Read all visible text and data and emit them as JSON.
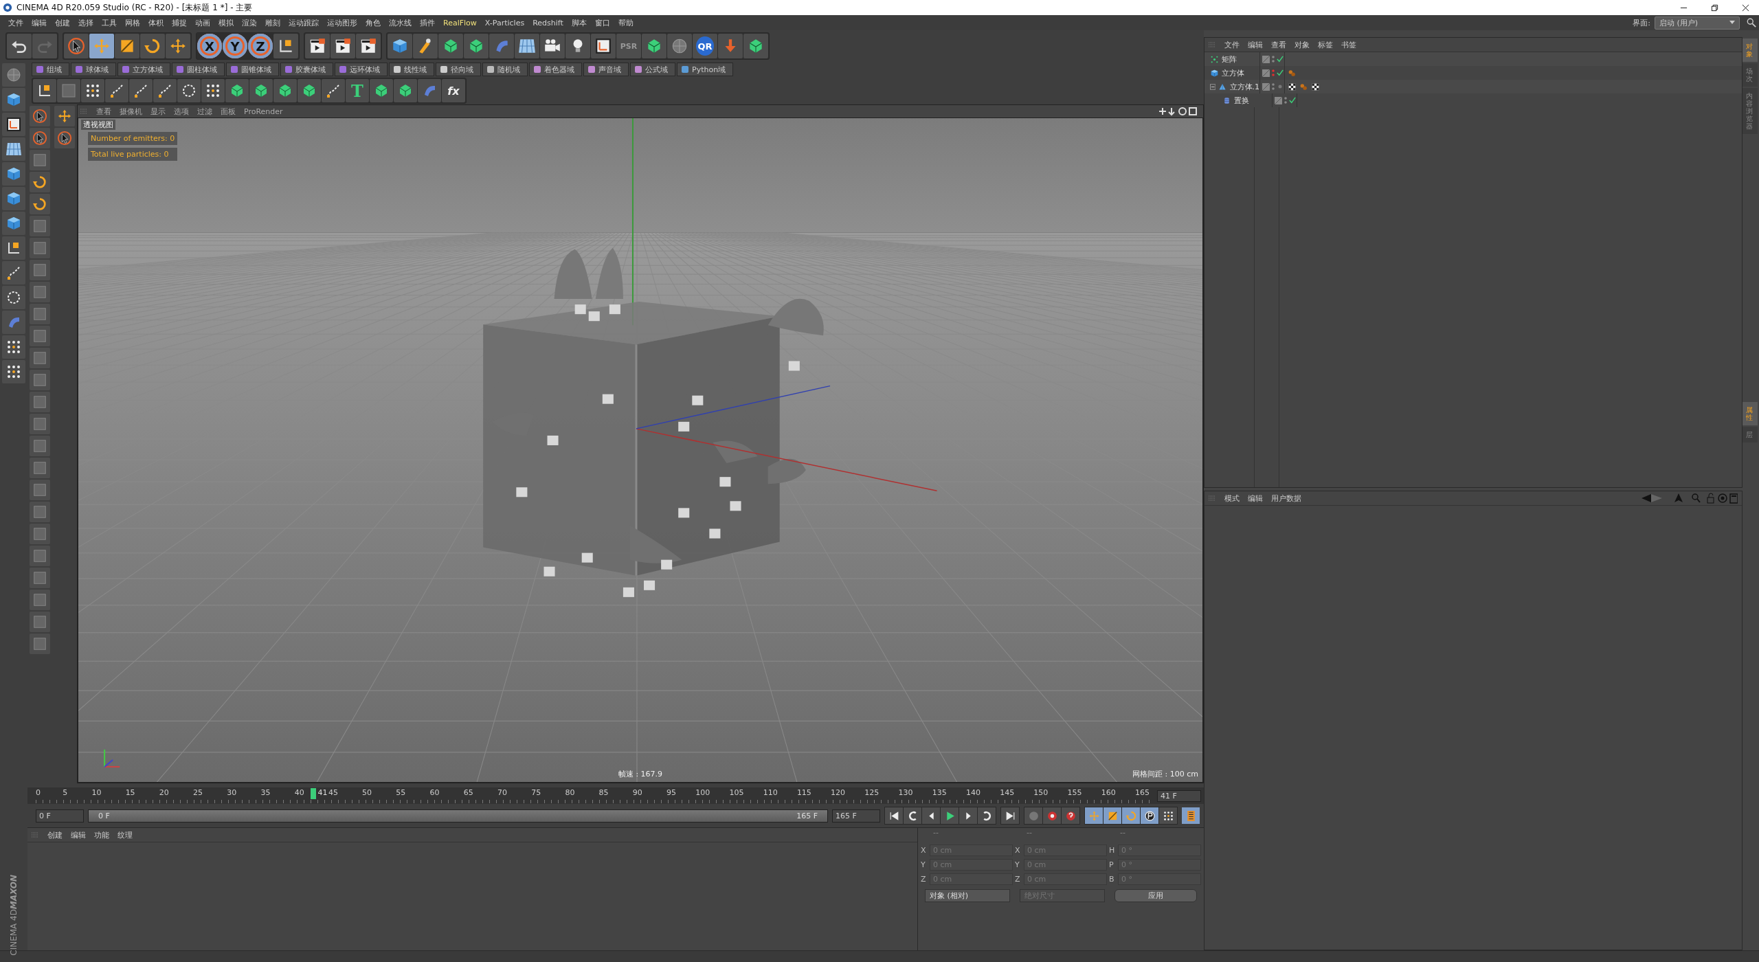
{
  "window": {
    "title": "CINEMA 4D R20.059 Studio (RC - R20) - [未标题 1 *] - 主要"
  },
  "menu": [
    "文件",
    "编辑",
    "创建",
    "选择",
    "工具",
    "网格",
    "体积",
    "捕捉",
    "动画",
    "模拟",
    "渲染",
    "雕刻",
    "运动跟踪",
    "运动图形",
    "角色",
    "流水线",
    "插件",
    "RealFlow",
    "X-Particles",
    "Redshift",
    "脚本",
    "窗口",
    "帮助"
  ],
  "layout_picker": {
    "label": "界面:",
    "value": "启动 (用户)"
  },
  "transform_tools": [
    {
      "selected": false
    },
    {
      "selected": true
    },
    {
      "selected": false
    },
    {
      "selected": false
    },
    {
      "selected": false
    }
  ],
  "axis_buttons": [
    {
      "label": "X",
      "selected": true
    },
    {
      "label": "Y",
      "selected": true
    },
    {
      "label": "Z",
      "selected": true
    }
  ],
  "icon_labels": {
    "psr": "PSR",
    "qr": "QR",
    "fx": "fx",
    "text_tool": "T"
  },
  "fields_toolbar": [
    "组域",
    "球体域",
    "立方体域",
    "圆柱体域",
    "圆锥体域",
    "胶囊体域",
    "远环体域",
    "线性域",
    "径向域",
    "随机域",
    "着色器域",
    "声音域",
    "公式域",
    "Python域"
  ],
  "viewport": {
    "menu": [
      "查看",
      "摄像机",
      "显示",
      "选项",
      "过滤",
      "面板",
      "ProRender"
    ],
    "view_name": "透视视图",
    "hud": [
      "Number of emitters: 0",
      "Total live particles: 0"
    ],
    "fps": "帧速 : 167.9",
    "grid_spacing": "网格间距 : 100 cm"
  },
  "object_manager": {
    "menu": [
      "文件",
      "编辑",
      "查看",
      "对象",
      "标签",
      "书签"
    ],
    "objects": [
      {
        "name": "矩阵",
        "kind": "matrix",
        "hidden": false,
        "enabled": true
      },
      {
        "name": "立方体",
        "kind": "cube",
        "hidden": true,
        "enabled": true,
        "tags": [
          {
            "kind": "material"
          }
        ]
      },
      {
        "name": "立方体.1",
        "kind": "volume",
        "hidden": false,
        "enabled": false,
        "expanded": true,
        "tags": [
          {
            "kind": "checker"
          },
          {
            "kind": "material"
          },
          {
            "kind": "checker"
          }
        ],
        "children": [
          {
            "name": "置换",
            "kind": "deformer",
            "hidden": false,
            "enabled": true
          }
        ]
      }
    ]
  },
  "right_tabs": [
    {
      "label": "对象",
      "selected": true
    },
    {
      "label": "场次",
      "selected": false
    },
    {
      "label": "内容浏览器",
      "selected": false
    }
  ],
  "attributes": {
    "menu": [
      "模式",
      "编辑",
      "用户数据"
    ]
  },
  "attribute_tabs": [
    {
      "label": "属性",
      "selected": true
    },
    {
      "label": "层",
      "selected": false
    }
  ],
  "timeline": {
    "ticks": [
      "0",
      "5",
      "10",
      "15",
      "20",
      "25",
      "30",
      "35",
      "40",
      "45",
      "50",
      "55",
      "60",
      "65",
      "70",
      "75",
      "80",
      "85",
      "90",
      "95",
      "100",
      "105",
      "110",
      "115",
      "120",
      "125",
      "130",
      "135",
      "140",
      "145",
      "150",
      "155",
      "160",
      "165"
    ],
    "playhead": {
      "label": "41",
      "level": 0.2485
    },
    "current": "41 F"
  },
  "transport": {
    "start": "0 F",
    "range": {
      "start": "0 F",
      "end": "165 F",
      "level": 1
    },
    "end": "165 F"
  },
  "material_manager": {
    "menu": [
      "创建",
      "编辑",
      "功能",
      "纹理"
    ]
  },
  "coordinates": {
    "headers": [
      "--",
      "--",
      "--"
    ],
    "rows": [
      {
        "a1": "X",
        "v1": "0 cm",
        "a2": "X",
        "v2": "0 cm",
        "a3": "H",
        "v3": "0 °"
      },
      {
        "a1": "Y",
        "v1": "0 cm",
        "a2": "Y",
        "v2": "0 cm",
        "a3": "P",
        "v3": "0 °"
      },
      {
        "a1": "Z",
        "v1": "0 cm",
        "a2": "Z",
        "v2": "0 cm",
        "a3": "B",
        "v3": "0 °"
      }
    ],
    "mode": "对象 (相对)",
    "size_mode": "绝对尺寸",
    "apply": "应用"
  },
  "brand": [
    "MAXON",
    "CINEMA 4D"
  ]
}
